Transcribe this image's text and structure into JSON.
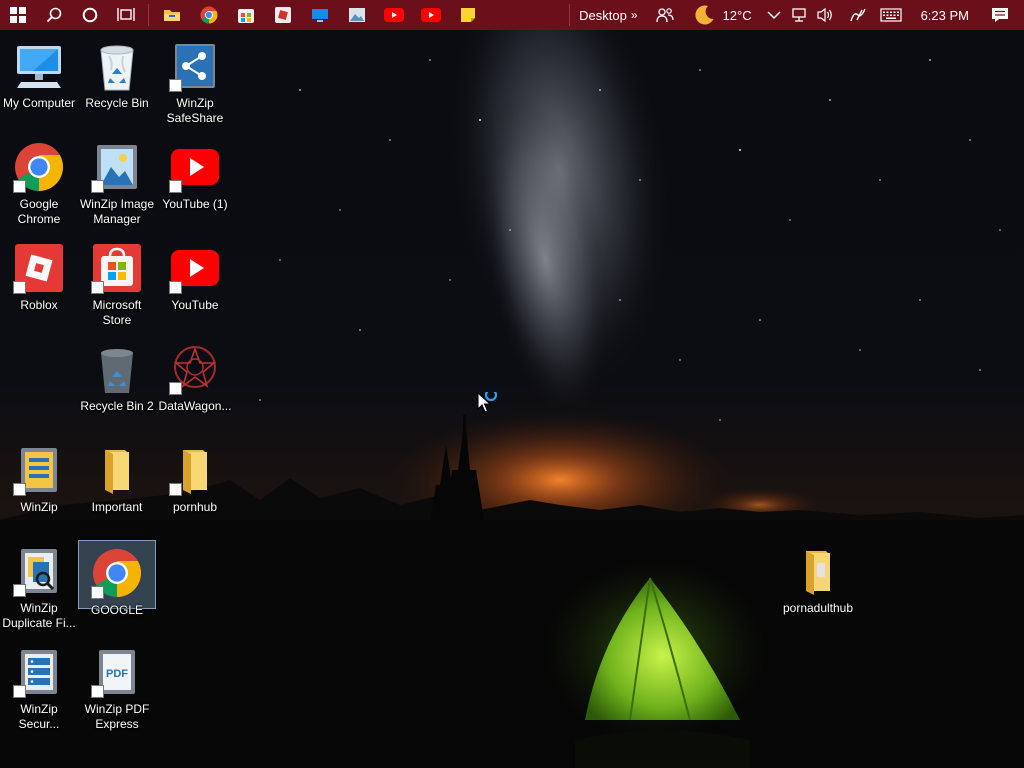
{
  "taskbar": {
    "pinned": [
      {
        "name": "file-explorer-icon"
      },
      {
        "name": "chrome-icon"
      },
      {
        "name": "store-icon"
      },
      {
        "name": "roblox-icon"
      },
      {
        "name": "monitor-app-icon"
      },
      {
        "name": "photos-icon"
      },
      {
        "name": "youtube-icon"
      },
      {
        "name": "youtube-icon"
      },
      {
        "name": "sticky-notes-icon"
      }
    ],
    "desktop_label": "Desktop",
    "desktop_chevron": "»",
    "temperature": "12°C",
    "time": "6:23 PM"
  },
  "desktop": {
    "icons": [
      {
        "label": "My Computer"
      },
      {
        "label": "Recycle Bin"
      },
      {
        "label": "WinZip SafeShare"
      },
      {
        "label": "Google Chrome"
      },
      {
        "label": "WinZip Image Manager"
      },
      {
        "label": "YouTube (1)"
      },
      {
        "label": "Roblox"
      },
      {
        "label": "Microsoft Store"
      },
      {
        "label": "YouTube"
      },
      {
        "label": "Recycle Bin 2"
      },
      {
        "label": "DataWagon..."
      },
      {
        "label": "WinZip"
      },
      {
        "label": "Important"
      },
      {
        "label": "pornhub"
      },
      {
        "label": "WinZip Duplicate Fi..."
      },
      {
        "label": "GOOGLE"
      },
      {
        "label": "pornadulthub"
      },
      {
        "label": "WinZip Secur..."
      },
      {
        "label": "WinZip PDF Express"
      }
    ]
  },
  "colors": {
    "taskbar": "#6b0f1a",
    "selection": "#6e8caa"
  }
}
